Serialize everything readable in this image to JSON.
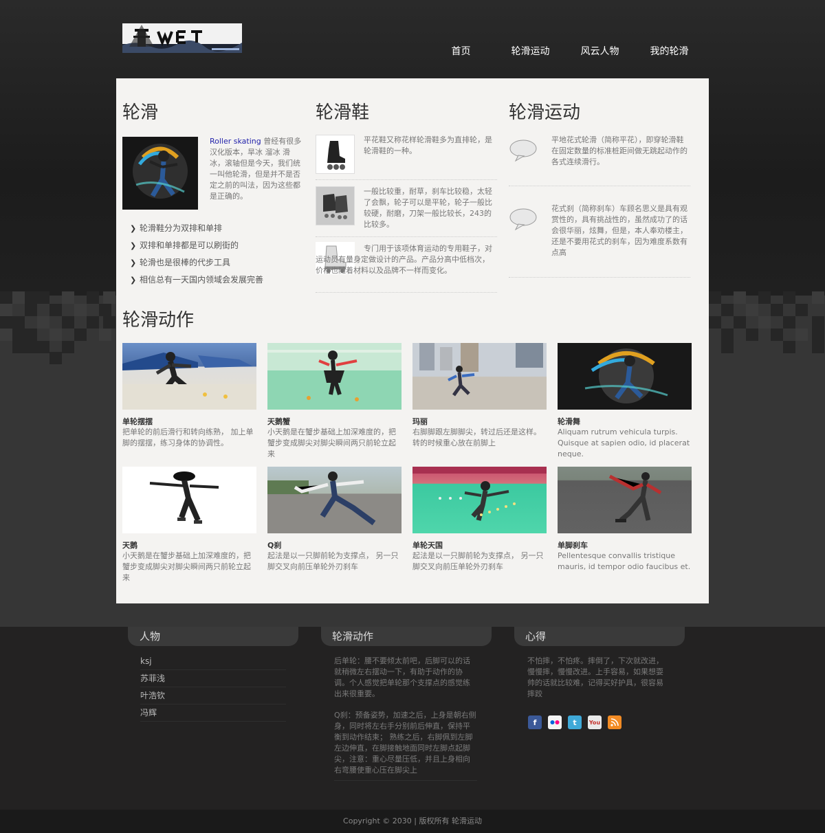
{
  "nav": {
    "items": [
      "首页",
      "轮滑运动",
      "风云人物",
      "我的轮滑"
    ]
  },
  "col1": {
    "title": "轮滑",
    "link": "Roller skating",
    "text": " 曾经有很多汉化版本，旱冰 溜冰 滑冰，滚轴但是今天，我们统一叫他轮滑，但是并不是否定之前的叫法，因为这些都是正确的。",
    "bullets": [
      "轮滑鞋分为双排和单排",
      "双排和单排都是可以刷街的",
      "轮滑也是很棒的代步工具",
      "相信总有一天国内领域会发展完善"
    ]
  },
  "col2": {
    "title": "轮滑鞋",
    "items": [
      "平花鞋又称花样轮滑鞋多为直排轮，是轮滑鞋的一种。",
      "一般比较重，耐草，刹车比较稳，太轻了会飘，轮子可以是平轮，轮子一般比较硬，耐磨，刀架一般比较长，243的比较多。",
      "专门用于该项体育运动的专用鞋子，对运动员有量身定做设计的产品。产品分高中低档次，价格也随着材料以及品牌不一样而变化。"
    ]
  },
  "col3": {
    "title": "轮滑运动",
    "items": [
      "平地花式轮滑（简称平花），即穿轮滑鞋在固定数量的标准桩距间做无跳起动作的各式连续滑行。",
      "花式刹（简称刹车）车顾名思义是具有观赏性的，具有挑战性的，虽然成功了的话会很华丽，炫舞，但是，本人奉劝楼主，还是不要用花式的刹车，因为难度系数有点高"
    ]
  },
  "actions": {
    "title": "轮滑动作",
    "items": [
      {
        "title": "单轮摆摆",
        "desc": "把单轮的前后滑行和转向练熟， 加上单脚的摆摆，练习身体的协调性。"
      },
      {
        "title": "天鹅蟹",
        "desc": "小天鹅是在蟹步基础上加深难度的，把蟹步变成脚尖对脚尖瞬间两只前轮立起来"
      },
      {
        "title": "玛丽",
        "desc": "右脚脚跟左脚脚尖，转过后还是这样。转的时候重心放在前脚上"
      },
      {
        "title": "轮滑舞",
        "desc": "Aliquam rutrum vehicula turpis. Quisque at sapien odio, id placerat neque."
      },
      {
        "title": "天鹅",
        "desc": "小天鹅是在蟹步基础上加深难度的，把蟹步变成脚尖对脚尖瞬间两只前轮立起来"
      },
      {
        "title": "Q刹",
        "desc": "起法是以一只脚前轮为支撑点， 另一只脚交叉向前压单轮外刃刹车"
      },
      {
        "title": "单轮天国",
        "desc": "起法是以一只脚前轮为支撑点， 另一只脚交叉向前压单轮外刃刹车"
      },
      {
        "title": "单脚刹车",
        "desc": "Pellentesque convallis tristique mauris, id tempor odio faucibus et."
      }
    ]
  },
  "footer": {
    "people_title": "人物",
    "people": [
      "ksj",
      "苏菲浅",
      "叶浩钦",
      "冯辉"
    ],
    "actions_title": "轮滑动作",
    "actions_text1": "后单轮：腰不要倾太前吧，后脚可以的话就稍微左右摆动一下，有助于动作的协调。个人感觉把单轮那个支撑点的感觉练出来很重要。",
    "actions_text2": "Q刹：预备姿势，加速之后，上身是朝右侧身，同时将左右手分别前后伸直，保持平衡到动作结束； 熟练之后，右脚佩到左脚左边伸直，在脚接触地面同时左脚点起脚尖，注意：重心尽量压低，并且上身相向右弯腰使重心压在脚尖上",
    "tips_title": "心得",
    "tips_text": "不怕摔，不怕疼。摔倒了，下次就改进，慢慢摔，慢慢改进。上手容易，如果想耍帅的话就比较难，记得买好护具，很容易摔跤",
    "social": [
      "facebook-icon",
      "flickr-icon",
      "twitter-icon",
      "youtube-icon",
      "rss-icon"
    ]
  },
  "copyright": "Copyright © 2030 | 版权所有 轮滑运动"
}
